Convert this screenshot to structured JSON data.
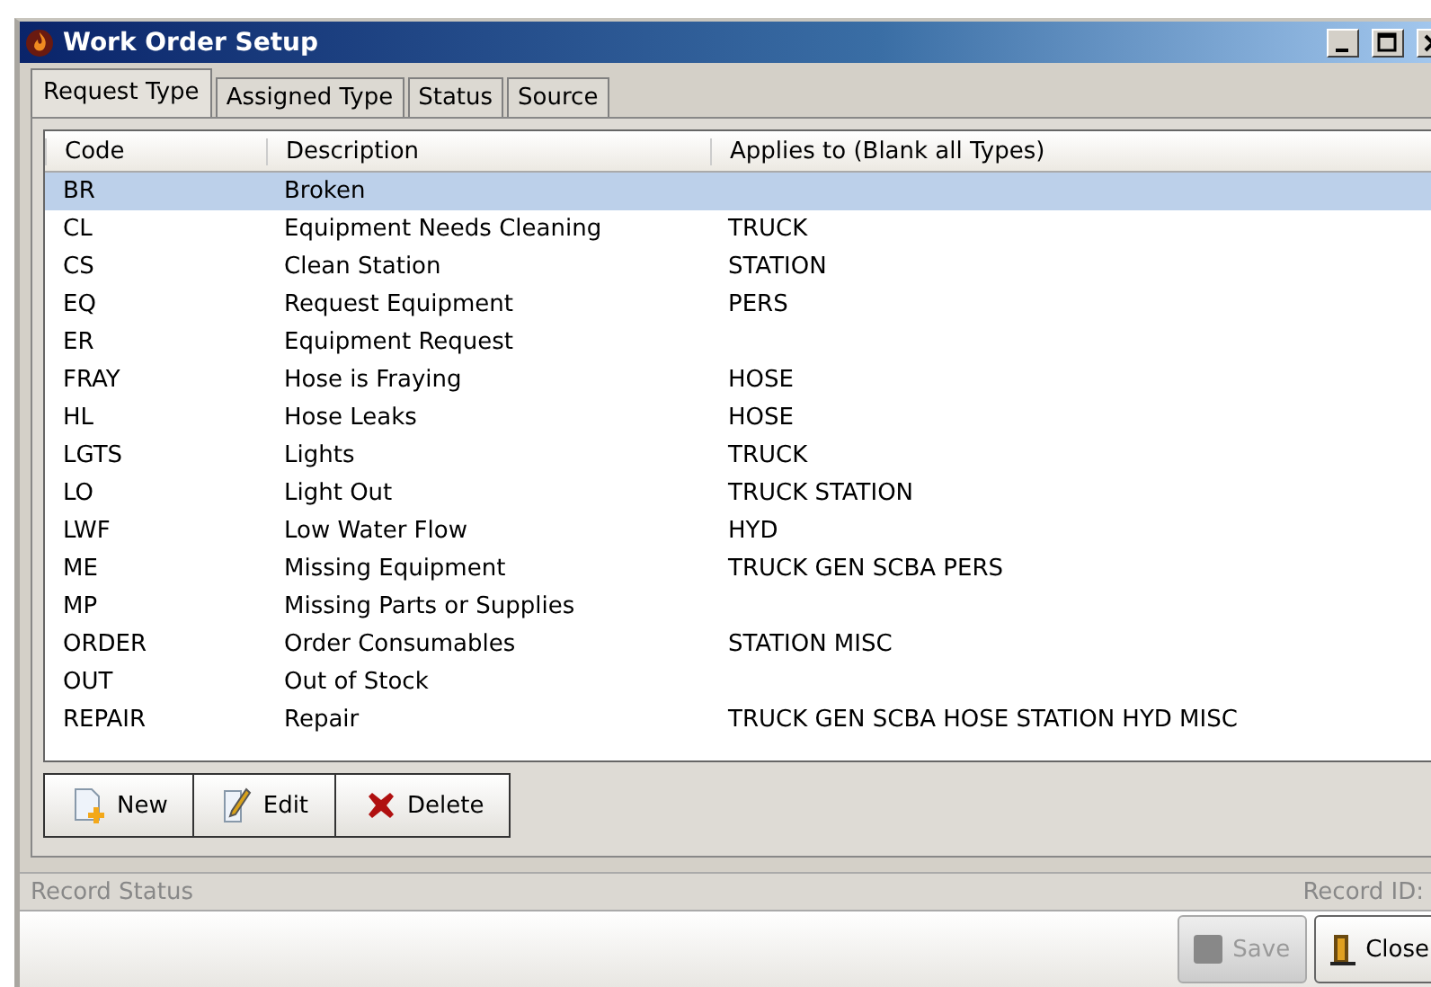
{
  "window": {
    "title": "Work Order Setup"
  },
  "tabs": [
    {
      "label": "Request Type",
      "selected": true
    },
    {
      "label": "Assigned Type",
      "selected": false
    },
    {
      "label": "Status",
      "selected": false
    },
    {
      "label": "Source",
      "selected": false
    }
  ],
  "table": {
    "columns": [
      "Code",
      "Description",
      "Applies to (Blank all Types)"
    ],
    "rows": [
      {
        "code": "BR",
        "description": "Broken",
        "applies_to": "",
        "selected": true
      },
      {
        "code": "CL",
        "description": "Equipment Needs Cleaning",
        "applies_to": "TRUCK",
        "selected": false
      },
      {
        "code": "CS",
        "description": "Clean Station",
        "applies_to": "STATION",
        "selected": false
      },
      {
        "code": "EQ",
        "description": "Request Equipment",
        "applies_to": "PERS",
        "selected": false
      },
      {
        "code": "ER",
        "description": "Equipment Request",
        "applies_to": "",
        "selected": false
      },
      {
        "code": "FRAY",
        "description": "Hose is Fraying",
        "applies_to": "HOSE",
        "selected": false
      },
      {
        "code": "HL",
        "description": "Hose Leaks",
        "applies_to": "HOSE",
        "selected": false
      },
      {
        "code": "LGTS",
        "description": "Lights",
        "applies_to": "TRUCK",
        "selected": false
      },
      {
        "code": "LO",
        "description": "Light Out",
        "applies_to": "TRUCK STATION",
        "selected": false
      },
      {
        "code": "LWF",
        "description": "Low Water Flow",
        "applies_to": "HYD",
        "selected": false
      },
      {
        "code": "ME",
        "description": "Missing Equipment",
        "applies_to": "TRUCK GEN SCBA PERS",
        "selected": false
      },
      {
        "code": "MP",
        "description": "Missing Parts or Supplies",
        "applies_to": "",
        "selected": false
      },
      {
        "code": "ORDER",
        "description": "Order Consumables",
        "applies_to": "STATION MISC",
        "selected": false
      },
      {
        "code": "OUT",
        "description": "Out of Stock",
        "applies_to": "",
        "selected": false
      },
      {
        "code": "REPAIR",
        "description": "Repair",
        "applies_to": "TRUCK GEN SCBA HOSE STATION HYD MISC",
        "selected": false
      }
    ]
  },
  "toolbar": [
    {
      "kind": "new",
      "label": "New"
    },
    {
      "kind": "edit",
      "label": "Edit"
    },
    {
      "kind": "delete",
      "label": "Delete"
    }
  ],
  "status_bar": {
    "label": "Record Status",
    "record_id_label": "Record ID:"
  },
  "footer_buttons": [
    {
      "kind": "save",
      "label": "Save",
      "disabled": true
    },
    {
      "kind": "close",
      "label": "Close",
      "disabled": false
    }
  ]
}
